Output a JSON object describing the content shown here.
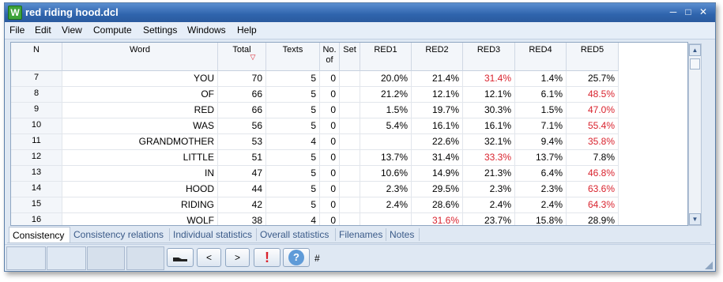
{
  "window": {
    "title": "red riding hood.dcl",
    "app_icon_letter": "W",
    "minimize": "─",
    "maximize": "□",
    "close": "✕"
  },
  "menu": [
    "File",
    "Edit",
    "View",
    "Compute",
    "Settings",
    "Windows",
    "Help"
  ],
  "table": {
    "headers": [
      "N",
      "Word",
      "Total",
      "Texts",
      "No. of",
      "Set",
      "RED1",
      "RED2",
      "RED3",
      "RED4",
      "RED5"
    ],
    "sort_indicator": "▽",
    "rows": [
      {
        "n": "7",
        "word": "YOU",
        "total": "70",
        "texts": "5",
        "noof": "0",
        "set": "",
        "red": [
          "20.0%",
          "21.4%",
          "31.4%",
          "1.4%",
          "25.7%"
        ],
        "hl": [
          false,
          false,
          true,
          false,
          false
        ]
      },
      {
        "n": "8",
        "word": "OF",
        "total": "66",
        "texts": "5",
        "noof": "0",
        "set": "",
        "red": [
          "21.2%",
          "12.1%",
          "12.1%",
          "6.1%",
          "48.5%"
        ],
        "hl": [
          false,
          false,
          false,
          false,
          true
        ]
      },
      {
        "n": "9",
        "word": "RED",
        "total": "66",
        "texts": "5",
        "noof": "0",
        "set": "",
        "red": [
          "1.5%",
          "19.7%",
          "30.3%",
          "1.5%",
          "47.0%"
        ],
        "hl": [
          false,
          false,
          false,
          false,
          true
        ]
      },
      {
        "n": "10",
        "word": "WAS",
        "total": "56",
        "texts": "5",
        "noof": "0",
        "set": "",
        "red": [
          "5.4%",
          "16.1%",
          "16.1%",
          "7.1%",
          "55.4%"
        ],
        "hl": [
          false,
          false,
          false,
          false,
          true
        ]
      },
      {
        "n": "11",
        "word": "GRANDMOTHER",
        "total": "53",
        "texts": "4",
        "noof": "0",
        "set": "",
        "red": [
          "",
          "22.6%",
          "32.1%",
          "9.4%",
          "35.8%"
        ],
        "hl": [
          false,
          false,
          false,
          false,
          true
        ]
      },
      {
        "n": "12",
        "word": "LITTLE",
        "total": "51",
        "texts": "5",
        "noof": "0",
        "set": "",
        "red": [
          "13.7%",
          "31.4%",
          "33.3%",
          "13.7%",
          "7.8%"
        ],
        "hl": [
          false,
          false,
          true,
          false,
          false
        ]
      },
      {
        "n": "13",
        "word": "IN",
        "total": "47",
        "texts": "5",
        "noof": "0",
        "set": "",
        "red": [
          "10.6%",
          "14.9%",
          "21.3%",
          "6.4%",
          "46.8%"
        ],
        "hl": [
          false,
          false,
          false,
          false,
          true
        ]
      },
      {
        "n": "14",
        "word": "HOOD",
        "total": "44",
        "texts": "5",
        "noof": "0",
        "set": "",
        "red": [
          "2.3%",
          "29.5%",
          "2.3%",
          "2.3%",
          "63.6%"
        ],
        "hl": [
          false,
          false,
          false,
          false,
          true
        ]
      },
      {
        "n": "15",
        "word": "RIDING",
        "total": "42",
        "texts": "5",
        "noof": "0",
        "set": "",
        "red": [
          "2.4%",
          "28.6%",
          "2.4%",
          "2.4%",
          "64.3%"
        ],
        "hl": [
          false,
          false,
          false,
          false,
          true
        ]
      },
      {
        "n": "16",
        "word": "WOLF",
        "total": "38",
        "texts": "4",
        "noof": "0",
        "set": "",
        "red": [
          "",
          "31.6%",
          "23.7%",
          "15.8%",
          "28.9%"
        ],
        "hl": [
          false,
          true,
          false,
          false,
          false
        ]
      }
    ]
  },
  "scroll": {
    "up": "▲",
    "down": "▼"
  },
  "tabs": [
    "Consistency",
    "Consistency relations",
    "Individual statistics",
    "Overall statistics",
    "Filenames",
    "Notes"
  ],
  "active_tab": "Consistency",
  "statusbar": {
    "prev": "<",
    "next": ">",
    "alert": "!",
    "help": "?",
    "hash": "#"
  },
  "colors": {
    "highlight": "#d9232e",
    "titlebar": "#2f64ad"
  }
}
